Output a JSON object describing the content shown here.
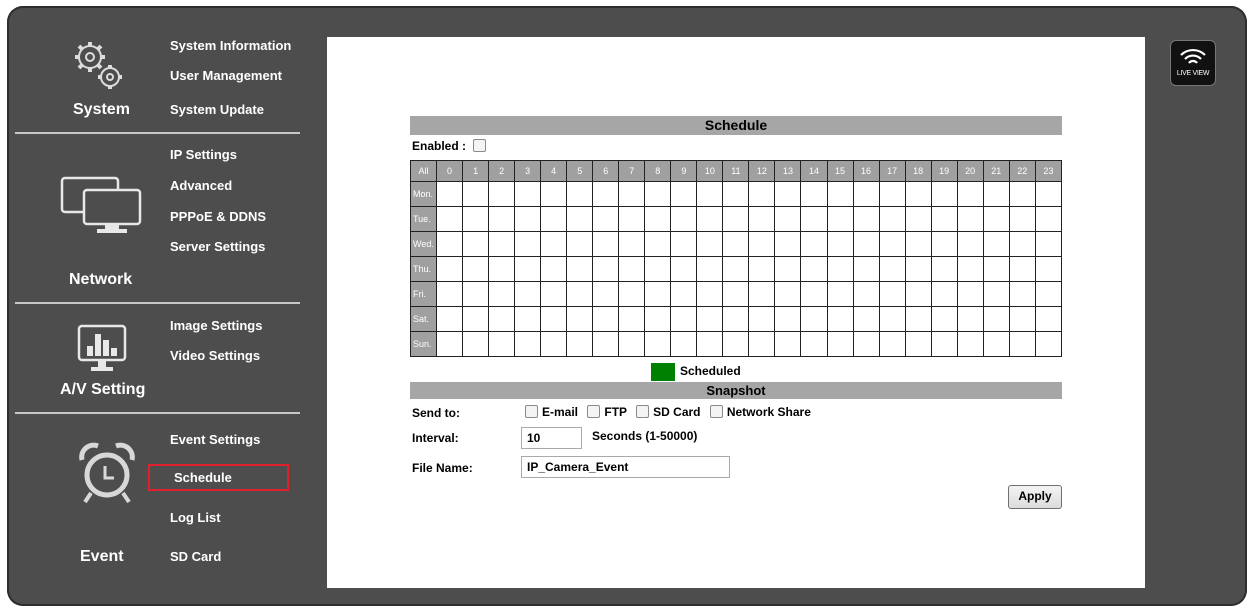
{
  "sidebar": {
    "system": {
      "label": "System",
      "items": [
        "System Information",
        "User Management",
        "System Update"
      ]
    },
    "network": {
      "label": "Network",
      "items": [
        "IP Settings",
        "Advanced",
        "PPPoE & DDNS",
        "Server Settings"
      ]
    },
    "av": {
      "label": "A/V Setting",
      "items": [
        "Image Settings",
        "Video Settings"
      ]
    },
    "event": {
      "label": "Event",
      "items": [
        "Event Settings",
        "Schedule",
        "Log List",
        "SD Card"
      ],
      "active": "Schedule"
    }
  },
  "live_view": {
    "label": "LIVE VIEW"
  },
  "schedule": {
    "title": "Schedule",
    "enabled_label": "Enabled :",
    "enabled": false,
    "all_label": "All",
    "hours": [
      "0",
      "1",
      "2",
      "3",
      "4",
      "5",
      "6",
      "7",
      "8",
      "9",
      "10",
      "11",
      "12",
      "13",
      "14",
      "15",
      "16",
      "17",
      "18",
      "19",
      "20",
      "21",
      "22",
      "23"
    ],
    "days": [
      "Mon.",
      "Tue.",
      "Wed.",
      "Thu.",
      "Fri.",
      "Sat.",
      "Sun."
    ],
    "legend_label": "Scheduled",
    "legend_color": "#008000"
  },
  "snapshot": {
    "title": "Snapshot",
    "send_to_label": "Send to:",
    "targets": [
      "E-mail",
      "FTP",
      "SD Card",
      "Network Share"
    ],
    "interval_label": "Interval:",
    "interval_value": "10",
    "interval_unit": "Seconds (1-50000)",
    "filename_label": "File Name:",
    "filename_value": "IP_Camera_Event",
    "apply_label": "Apply"
  }
}
